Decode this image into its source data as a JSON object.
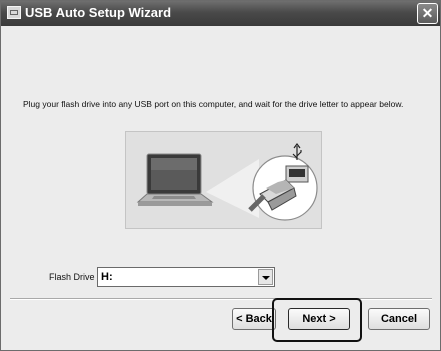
{
  "window": {
    "title": "USB Auto Setup Wizard",
    "close_glyph": "✕"
  },
  "instruction": "Plug your flash drive into any USB port on this computer, and wait for the drive letter to appear below.",
  "flash_drive": {
    "label": "Flash Drive :",
    "value": "H:"
  },
  "buttons": {
    "back": "< Back",
    "next": "Next >",
    "cancel": "Cancel"
  },
  "icons": [
    "app-icon",
    "close-icon",
    "laptop-icon",
    "usb-plug-icon",
    "usb-symbol-icon",
    "chevron-down-icon"
  ]
}
